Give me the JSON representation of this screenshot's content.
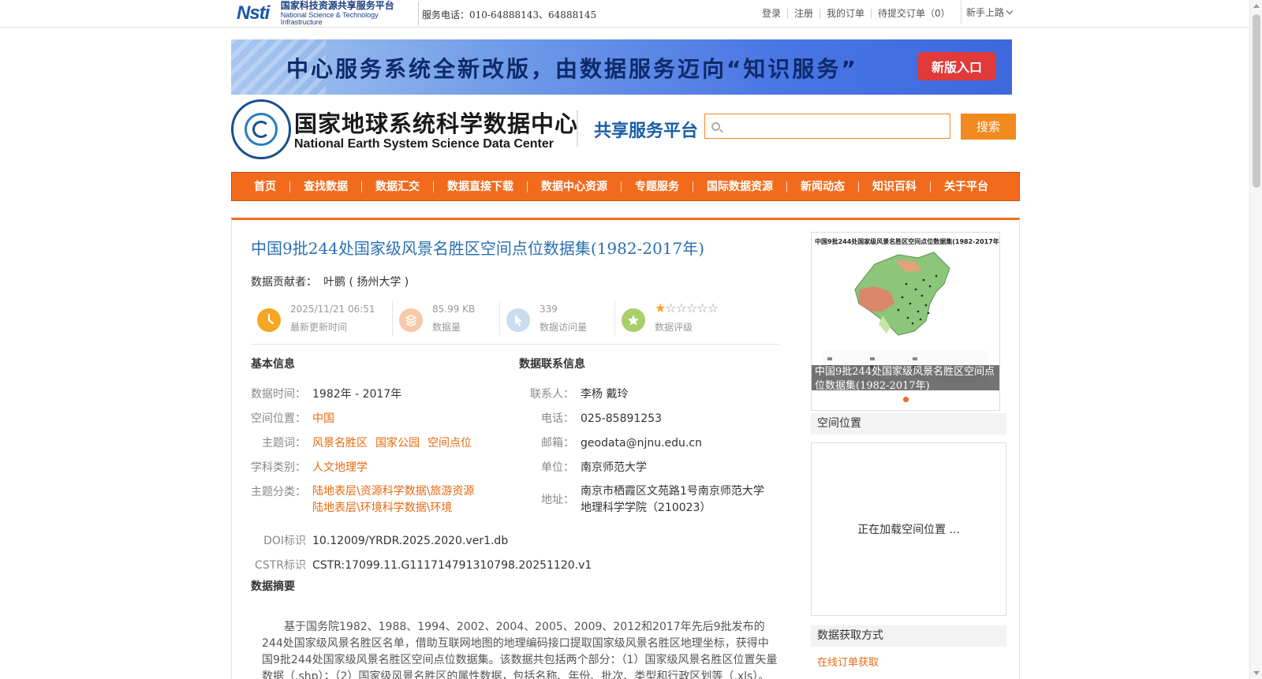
{
  "topbar": {
    "logo_mark": "Nsti",
    "logo_cn": "国家科技资源共享服务平台",
    "logo_en": "National Science & Technology Infrastructure",
    "phone": "服务电话：010-64888143、64888145",
    "links": [
      "登录",
      "注册",
      "我的订单",
      "待提交订单（0）"
    ],
    "guide": "新手上路"
  },
  "banner": {
    "message": "中心服务系统全新改版，由数据服务迈向“知识服务”",
    "button": "新版入口"
  },
  "header": {
    "name_cn": "国家地球系统科学数据中心",
    "name_en": "National Earth System Science Data Center",
    "platform": "共享服务平台",
    "search_value": "",
    "search_button": "搜索"
  },
  "nav": [
    "首页",
    "查找数据",
    "数据汇交",
    "数据直接下载",
    "数据中心资源",
    "专题服务",
    "国际数据资源",
    "新闻动态",
    "知识百科",
    "关于平台"
  ],
  "dataset": {
    "title": "中国9批244处国家级风景名胜区空间点位数据集(1982-2017年)",
    "contributor_label": "数据贡献者：",
    "contributor": "叶鹏 ( 扬州大学 )"
  },
  "stats": [
    {
      "value": "2025/11/21 06:51",
      "label": "最新更新时间",
      "color": "#f5a623"
    },
    {
      "value": "85.99 KB",
      "label": "数据量",
      "color": "#f7c9a8"
    },
    {
      "value": "339",
      "label": "数据访问量",
      "color": "#c9dcf0"
    },
    {
      "value": "",
      "label": "数据评级",
      "color": "#a8cf6a"
    }
  ],
  "rating": {
    "stars_on": 1,
    "stars_total": 6
  },
  "basic": {
    "title": "基本信息",
    "time_label": "数据时间：",
    "time": "1982年 - 2017年",
    "location_label": "空间位置：",
    "location": "中国",
    "keywords_label": "主题词：",
    "keywords": [
      "风景名胜区",
      "国家公园",
      "空间点位"
    ],
    "discipline_label": "学科类别：",
    "discipline": "人文地理学",
    "category_label": "主题分类：",
    "category_1": "陆地表层\\资源科学数据\\旅游资源",
    "category_2": "陆地表层\\环境科学数据\\环境",
    "doi_label": "DOI标识",
    "doi": "10.12009/YRDR.2025.2020.ver1.db",
    "cstr_label": "CSTR标识",
    "cstr": "CSTR:17099.11.G111714791310798.20251120.v1"
  },
  "contact": {
    "title": "数据联系信息",
    "person_label": "联系人：",
    "person": "李杨 戴玲",
    "phone_label": "电话：",
    "phone": "025-85891253",
    "email_label": "邮箱：",
    "email": "geodata@njnu.edu.cn",
    "unit_label": "单位：",
    "unit": "南京师范大学",
    "address_label": "地址：",
    "address_1": "南京市栖霞区文苑路1号南京师范大学",
    "address_2": "地理科学学院（210023）"
  },
  "abstract": {
    "title": "数据摘要",
    "text": "基于国务院1982、1988、1994、2002、2004、2005、2009、2012和2017年先后9批发布的244处国家级风景名胜区名单，借助互联网地图的地理编码接口提取国家级风景名胜区地理坐标，获得中国9批244处国家级风景名胜区空间点位数据集。该数据共包括两个部分：（1）国家级风景名胜区位置矢量数据（.shp）；（2）国家级风景名胜区的属性数据，包括名称、年份、批次、类型和行政区划等（.xls）。"
  },
  "sidebar": {
    "image_caption": "中国9批244处国家级风景名胜区空间点位数据集(1982-2017年)",
    "image_overlay": "中国9批244处国家级风景名胜区空间点位数据集(1982-2017年)",
    "spatial_title": "空间位置",
    "loading": "正在加载空间位置 ...",
    "access_title": "数据获取方式",
    "order_link": "在线订单获取"
  }
}
